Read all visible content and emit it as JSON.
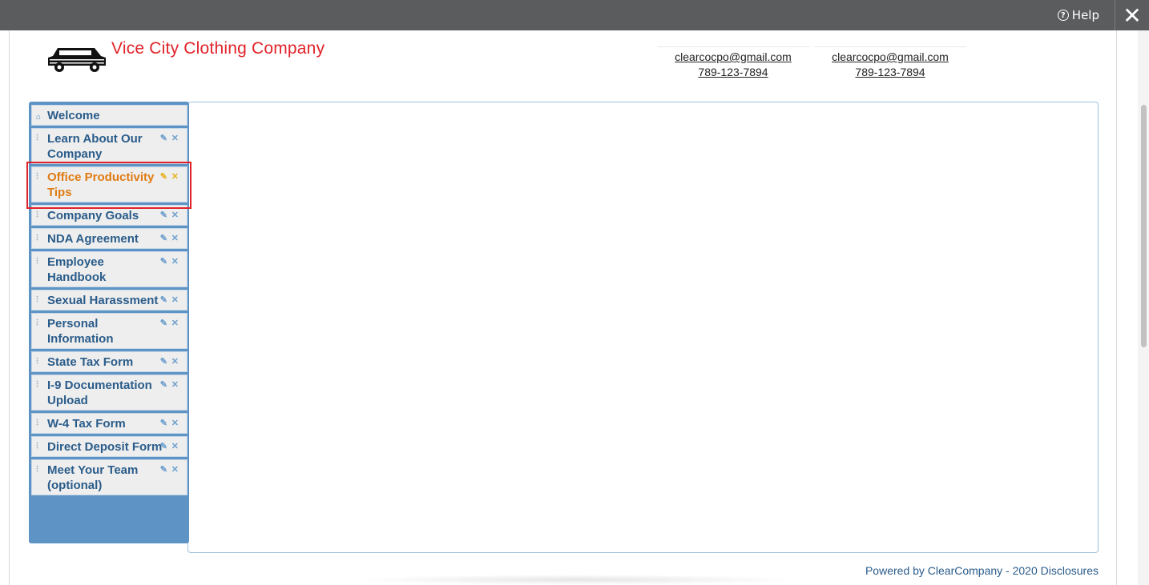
{
  "topbar": {
    "help_label": "Help",
    "help_icon": "question-circle-icon",
    "close_icon": "close-icon"
  },
  "header": {
    "company_name": "Vice City Clothing Company",
    "logo_icon": "car-logo-icon",
    "contacts": [
      {
        "email": "clearcocpo@gmail.com",
        "phone": "789-123-7894"
      },
      {
        "email": "clearcocpo@gmail.com",
        "phone": "789-123-7894"
      }
    ]
  },
  "nav": {
    "items": [
      {
        "label": "Welcome",
        "home": true
      },
      {
        "label": "Learn About Our Company"
      },
      {
        "label": "Office Productivity Tips",
        "active": true
      },
      {
        "label": "Company Goals"
      },
      {
        "label": "NDA Agreement"
      },
      {
        "label": "Employee Handbook"
      },
      {
        "label": "Sexual Harassment"
      },
      {
        "label": "Personal Information"
      },
      {
        "label": "State Tax Form"
      },
      {
        "label": "I-9 Documentation Upload"
      },
      {
        "label": "W-4 Tax Form"
      },
      {
        "label": "Direct Deposit Form"
      },
      {
        "label": "Meet Your Team (optional)"
      }
    ]
  },
  "footer": {
    "powered_by": "Powered by ClearCompany - 2020",
    "disclosures": "Disclosures"
  },
  "colors": {
    "topbar": "#5b5c5e",
    "nav_text": "#2a5c8a",
    "active_text": "#e07b12",
    "brand_red": "#e0232a",
    "nav_bg": "#5e93c6"
  }
}
